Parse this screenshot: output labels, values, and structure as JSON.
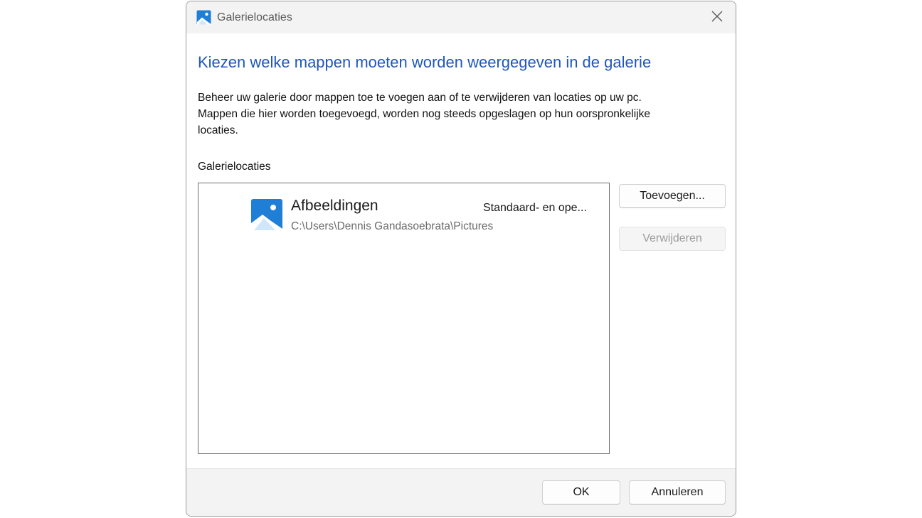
{
  "window": {
    "title": "Galerielocaties",
    "icon": "gallery-icon",
    "close_icon": "close-icon"
  },
  "content": {
    "heading": "Kiezen welke mappen moeten worden weergegeven in de galerie",
    "description_lines": [
      "Beheer uw galerie door mappen toe te voegen aan of te verwijderen van locaties op uw pc.",
      "Mappen die hier worden toegevoegd, worden nog steeds opgeslagen op hun oorspronkelijke",
      "locaties."
    ],
    "list_label": "Galerielocaties"
  },
  "locations": [
    {
      "name": "Afbeeldingen",
      "path": "C:\\Users\\Dennis Gandasoebrata\\Pictures",
      "status": "Standaard- en ope...",
      "icon": "pictures-folder-icon"
    }
  ],
  "buttons": {
    "add": "Toevoegen...",
    "remove": "Verwijderen",
    "ok": "OK",
    "cancel": "Annuleren"
  },
  "colors": {
    "accent": "#1f57b8",
    "icon_blue": "#1f7fd6"
  }
}
